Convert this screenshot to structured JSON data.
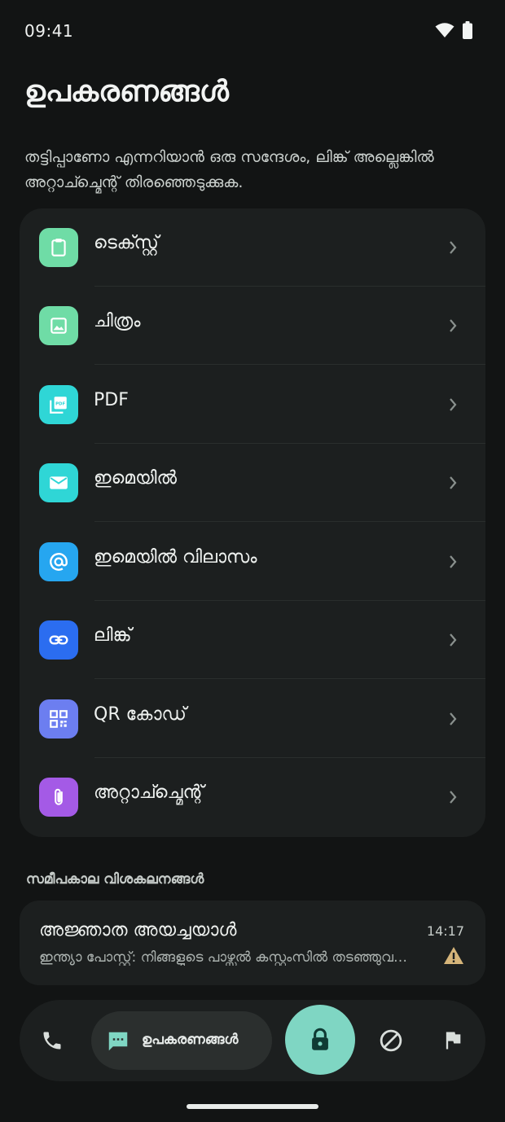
{
  "status_bar": {
    "time": "09:41",
    "wifi_icon": "wifi-icon",
    "battery_icon": "battery-icon"
  },
  "header": {
    "title": "ഉപകരണങ്ങൾ",
    "description": "തട്ടിപ്പാണോ എന്നറിയാൻ ഒരു സന്ദേശം, ലിങ്ക് അല്ലെങ്കിൽ അറ്റാച്ച്മെന്റ് തിരഞ്ഞെടുക്കുക."
  },
  "tools": {
    "items": [
      {
        "label": "ടെക്സ്റ്റ്",
        "icon": "clipboard-icon",
        "color": "#6fdca6"
      },
      {
        "label": "ചിത്രം",
        "icon": "image-icon",
        "color": "#6fdca6"
      },
      {
        "label": "PDF",
        "icon": "pdf-icon",
        "color": "#2fd6d6"
      },
      {
        "label": "ഇമെയിൽ",
        "icon": "mail-icon",
        "color": "#2fd6d6"
      },
      {
        "label": "ഇമെയിൽ വിലാസം",
        "icon": "at-icon",
        "color": "#26a6f0"
      },
      {
        "label": "ലിങ്ക്",
        "icon": "link-icon",
        "color": "#2b6df0"
      },
      {
        "label": "QR കോഡ്",
        "icon": "qr-code-icon",
        "color": "#6c7ef0"
      },
      {
        "label": "അറ്റാച്ച്മെന്റ്",
        "icon": "paperclip-icon",
        "color": "#a45ae6"
      }
    ]
  },
  "recent": {
    "section_title": "സമീപകാല വിശകലനങ്ങൾ",
    "items": [
      {
        "sender": "അജ്ഞാത അയച്ചയാൾ",
        "preview": "ഇന്ത്യാ പോസ്റ്റ്: നിങ്ങളുടെ പാഴ്സൽ കസ്റ്റംസിൽ തടഞ്ഞുവച്ചിരിക്കുന്നു",
        "time": "14:17",
        "status_icon": "warning-icon",
        "status_color": "#d6b57a"
      }
    ]
  },
  "bottom_nav": {
    "call_icon": "phone-icon",
    "tools_label": "ഉപകരണങ്ങൾ",
    "tools_icon": "chat-icon",
    "lock_icon": "lock-icon",
    "lock_color": "#7fd6c3",
    "block_icon": "block-icon",
    "flag_icon": "flag-icon"
  }
}
